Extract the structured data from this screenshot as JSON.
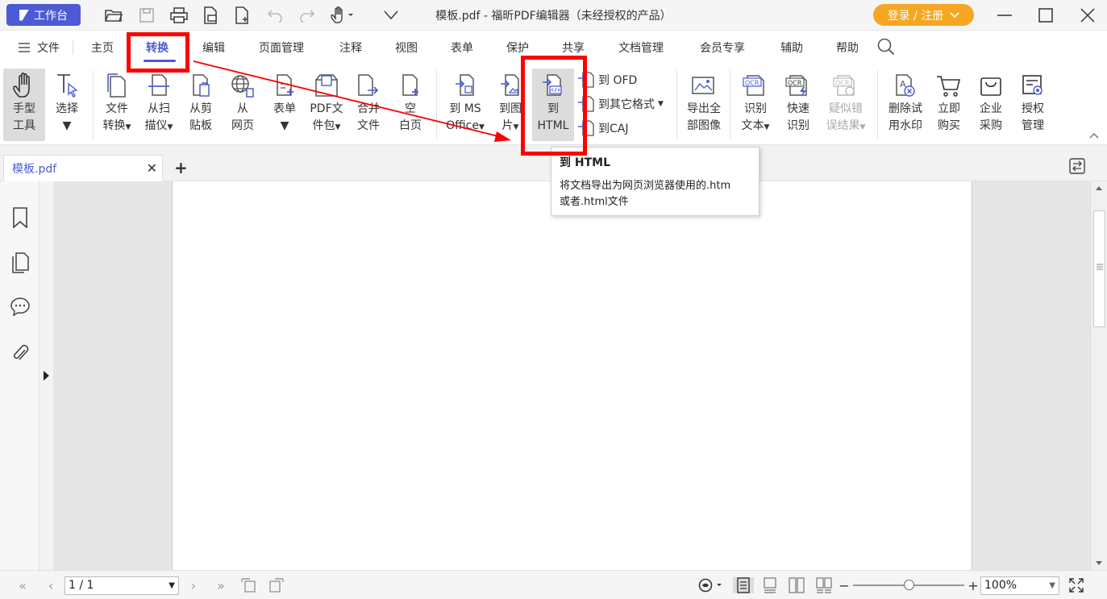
{
  "titlebar": {
    "workbench_label": "工作台",
    "title": "模板.pdf - 福昕PDF编辑器（未经授权的产品）",
    "login_label": "登录 / 注册"
  },
  "menu": {
    "file_label": "文件",
    "tabs": [
      "主页",
      "转换",
      "编辑",
      "页面管理",
      "注释",
      "视图",
      "表单",
      "保护",
      "共享",
      "文档管理",
      "会员专享",
      "辅助",
      "帮助"
    ],
    "active_tab": "转换"
  },
  "ribbon": {
    "hand_tool": [
      "手型",
      "工具"
    ],
    "select": [
      "选择"
    ],
    "file_convert": [
      "文件",
      "转换"
    ],
    "from_scanner": [
      "从扫",
      "描仪"
    ],
    "from_clipboard": [
      "从剪",
      "贴板"
    ],
    "from_web": [
      "从",
      "网页"
    ],
    "form": [
      "表单"
    ],
    "pdf_package": [
      "PDF文",
      "件包"
    ],
    "merge_files": [
      "合并",
      "文件"
    ],
    "blank_page": [
      "空",
      "白页"
    ],
    "to_ms_office": [
      "到 MS",
      "Office"
    ],
    "to_image": [
      "到图",
      "片"
    ],
    "to_html": [
      "到",
      "HTML"
    ],
    "to_ofd": "到 OFD",
    "to_other_formats": "到其它格式",
    "to_caj": "到CAJ",
    "export_all_images": [
      "导出全",
      "部图像"
    ],
    "ocr_text": [
      "识别",
      "文本"
    ],
    "quick_ocr": [
      "快速",
      "识别"
    ],
    "suspect_results": [
      "疑似错",
      "误结果"
    ],
    "remove_watermark": [
      "删除试",
      "用水印"
    ],
    "buy_now": [
      "立即",
      "购买"
    ],
    "enterprise_purchase": [
      "企业",
      "采购"
    ],
    "license_management": [
      "授权",
      "管理"
    ]
  },
  "doc_tab": {
    "name": "模板.pdf"
  },
  "tooltip": {
    "title": "到 HTML",
    "description_line1": "将文档导出为网页浏览器使用的.htm",
    "description_line2": "或者.html文件"
  },
  "statusbar": {
    "page_indicator": "1 / 1",
    "zoom": "100%",
    "zoom_level": 0.45
  },
  "colors": {
    "accent": "#4c5bd4",
    "login_orange": "#f5a623",
    "annotation_red": "#ff0000"
  }
}
